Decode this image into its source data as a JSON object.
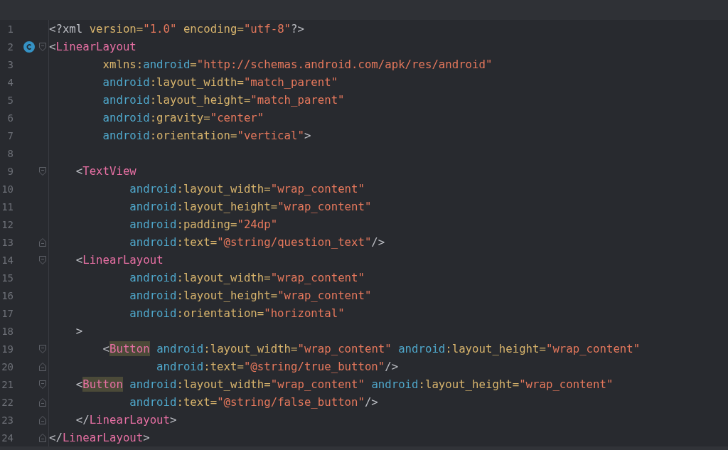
{
  "editor": {
    "lines": [
      {
        "number": "1",
        "tokens": [
          {
            "kind": "punct",
            "text": "<?xml "
          },
          {
            "kind": "attr",
            "text": "version="
          },
          {
            "kind": "value",
            "text": "\"1.0\""
          },
          {
            "kind": "attr",
            "text": " encoding="
          },
          {
            "kind": "value",
            "text": "\"utf-8\""
          },
          {
            "kind": "punct",
            "text": "?>"
          }
        ]
      },
      {
        "number": "2",
        "gutter_badge": {
          "kind": "class"
        },
        "fold_marker": {
          "kind": "start"
        },
        "tokens": [
          {
            "kind": "punct",
            "text": "<"
          },
          {
            "kind": "tag",
            "text": "LinearLayout"
          }
        ]
      },
      {
        "number": "3",
        "tokens": [
          {
            "kind": "attr",
            "text": "        xmlns:"
          },
          {
            "kind": "ns",
            "text": "android"
          },
          {
            "kind": "attr",
            "text": "="
          },
          {
            "kind": "value",
            "text": "\"http://schemas.android.com/apk/res/android\""
          }
        ]
      },
      {
        "number": "4",
        "tokens": [
          {
            "kind": "ns",
            "text": "        android"
          },
          {
            "kind": "attr",
            "text": ":layout_width="
          },
          {
            "kind": "value",
            "text": "\"match_parent\""
          }
        ]
      },
      {
        "number": "5",
        "tokens": [
          {
            "kind": "ns",
            "text": "        android"
          },
          {
            "kind": "attr",
            "text": ":layout_height="
          },
          {
            "kind": "value",
            "text": "\"match_parent\""
          }
        ]
      },
      {
        "number": "6",
        "tokens": [
          {
            "kind": "ns",
            "text": "        android"
          },
          {
            "kind": "attr",
            "text": ":gravity="
          },
          {
            "kind": "value",
            "text": "\"center\""
          }
        ]
      },
      {
        "number": "7",
        "tokens": [
          {
            "kind": "ns",
            "text": "        android"
          },
          {
            "kind": "attr",
            "text": ":orientation="
          },
          {
            "kind": "value",
            "text": "\"vertical\""
          },
          {
            "kind": "punct",
            "text": ">"
          }
        ]
      },
      {
        "number": "8"
      },
      {
        "number": "9",
        "fold_marker": {
          "kind": "start"
        },
        "tokens": [
          {
            "kind": "punct",
            "text": "    <"
          },
          {
            "kind": "tag",
            "text": "TextView"
          }
        ]
      },
      {
        "number": "10",
        "tokens": [
          {
            "kind": "ns",
            "text": "            android"
          },
          {
            "kind": "attr",
            "text": ":layout_width="
          },
          {
            "kind": "value",
            "text": "\"wrap_content\""
          }
        ]
      },
      {
        "number": "11",
        "tokens": [
          {
            "kind": "ns",
            "text": "            android"
          },
          {
            "kind": "attr",
            "text": ":layout_height="
          },
          {
            "kind": "value",
            "text": "\"wrap_content\""
          }
        ]
      },
      {
        "number": "12",
        "tokens": [
          {
            "kind": "ns",
            "text": "            android"
          },
          {
            "kind": "attr",
            "text": ":padding="
          },
          {
            "kind": "value",
            "text": "\"24dp\""
          }
        ]
      },
      {
        "number": "13",
        "fold_marker": {
          "kind": "end"
        },
        "tokens": [
          {
            "kind": "ns",
            "text": "            android"
          },
          {
            "kind": "attr",
            "text": ":text="
          },
          {
            "kind": "value",
            "text": "\"@string/question_text\""
          },
          {
            "kind": "punct",
            "text": "/>"
          }
        ]
      },
      {
        "number": "14",
        "fold_marker": {
          "kind": "start"
        },
        "tokens": [
          {
            "kind": "punct",
            "text": "    <"
          },
          {
            "kind": "tag",
            "text": "LinearLayout"
          }
        ]
      },
      {
        "number": "15",
        "tokens": [
          {
            "kind": "ns",
            "text": "            android"
          },
          {
            "kind": "attr",
            "text": ":layout_width="
          },
          {
            "kind": "value",
            "text": "\"wrap_content\""
          }
        ]
      },
      {
        "number": "16",
        "tokens": [
          {
            "kind": "ns",
            "text": "            android"
          },
          {
            "kind": "attr",
            "text": ":layout_height="
          },
          {
            "kind": "value",
            "text": "\"wrap_content\""
          }
        ]
      },
      {
        "number": "17",
        "tokens": [
          {
            "kind": "ns",
            "text": "            android"
          },
          {
            "kind": "attr",
            "text": ":orientation="
          },
          {
            "kind": "value",
            "text": "\"horizontal\""
          }
        ]
      },
      {
        "number": "18",
        "tokens": [
          {
            "kind": "punct",
            "text": "    >"
          }
        ]
      },
      {
        "number": "19",
        "fold_marker": {
          "kind": "start"
        },
        "tokens": [
          {
            "kind": "punct",
            "text": "        <"
          },
          {
            "kind": "tag",
            "text": "Button",
            "highlighted": true
          },
          {
            "kind": "ns",
            "text": " android"
          },
          {
            "kind": "attr",
            "text": ":layout_width="
          },
          {
            "kind": "value",
            "text": "\"wrap_content\""
          },
          {
            "kind": "ns",
            "text": " android"
          },
          {
            "kind": "attr",
            "text": ":layout_height="
          },
          {
            "kind": "value",
            "text": "\"wrap_content\""
          }
        ]
      },
      {
        "number": "20",
        "fold_marker": {
          "kind": "end"
        },
        "tokens": [
          {
            "kind": "ns",
            "text": "                android"
          },
          {
            "kind": "attr",
            "text": ":text="
          },
          {
            "kind": "value",
            "text": "\"@string/true_button\""
          },
          {
            "kind": "punct",
            "text": "/>"
          }
        ]
      },
      {
        "number": "21",
        "fold_marker": {
          "kind": "start"
        },
        "tokens": [
          {
            "kind": "punct",
            "text": "    <"
          },
          {
            "kind": "tag",
            "text": "Button",
            "highlighted": true
          },
          {
            "kind": "ns",
            "text": " android"
          },
          {
            "kind": "attr",
            "text": ":layout_width="
          },
          {
            "kind": "value",
            "text": "\"wrap_content\""
          },
          {
            "kind": "ns",
            "text": " android"
          },
          {
            "kind": "attr",
            "text": ":layout_height="
          },
          {
            "kind": "value",
            "text": "\"wrap_content\""
          }
        ]
      },
      {
        "number": "22",
        "fold_marker": {
          "kind": "end"
        },
        "tokens": [
          {
            "kind": "ns",
            "text": "            android"
          },
          {
            "kind": "attr",
            "text": ":text="
          },
          {
            "kind": "value",
            "text": "\"@string/false_button\""
          },
          {
            "kind": "punct",
            "text": "/>"
          }
        ]
      },
      {
        "number": "23",
        "fold_marker": {
          "kind": "end"
        },
        "tokens": [
          {
            "kind": "punct",
            "text": "    </"
          },
          {
            "kind": "tag",
            "text": "LinearLayout"
          },
          {
            "kind": "punct",
            "text": ">"
          }
        ]
      },
      {
        "number": "24",
        "fold_marker": {
          "kind": "end"
        },
        "tokens": [
          {
            "kind": "punct",
            "text": "</"
          },
          {
            "kind": "tag",
            "text": "LinearLayout"
          },
          {
            "kind": "punct",
            "text": ">"
          }
        ]
      }
    ]
  }
}
